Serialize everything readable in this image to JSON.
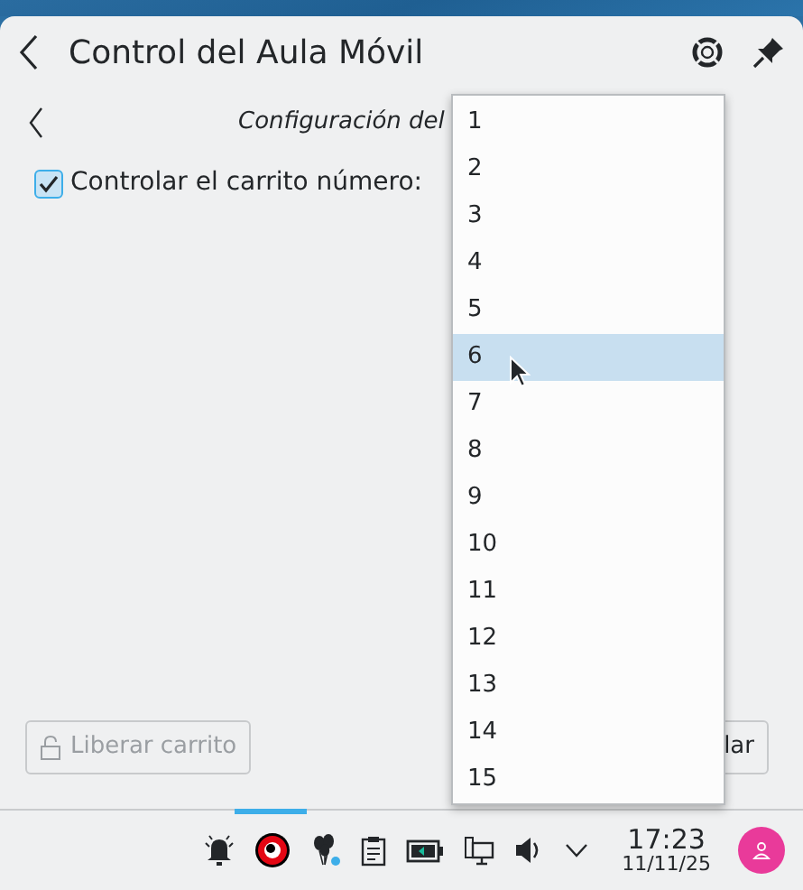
{
  "header": {
    "title": "Control del Aula Móvil"
  },
  "subheader": {
    "title": "Configuración del"
  },
  "carrito_checkbox": {
    "label": "Controlar el carrito número:",
    "checked": true
  },
  "dropdown": {
    "items": [
      {
        "label": "1",
        "selected": false
      },
      {
        "label": "2",
        "selected": false
      },
      {
        "label": "3",
        "selected": false
      },
      {
        "label": "4",
        "selected": false
      },
      {
        "label": "5",
        "selected": false
      },
      {
        "label": "6",
        "selected": true
      },
      {
        "label": "7",
        "selected": false
      },
      {
        "label": "8",
        "selected": false
      },
      {
        "label": "9",
        "selected": false
      },
      {
        "label": "10",
        "selected": false
      },
      {
        "label": "11",
        "selected": false
      },
      {
        "label": "12",
        "selected": false
      },
      {
        "label": "13",
        "selected": false
      },
      {
        "label": "14",
        "selected": false
      },
      {
        "label": "15",
        "selected": false
      }
    ]
  },
  "buttons": [
    {
      "label": "Liberar carrito",
      "disabled": true,
      "kind": "lock"
    },
    {
      "label": "lar",
      "disabled": false,
      "kind": "plain"
    }
  ],
  "taskbar": {
    "time": "17:23",
    "date": "11/11/25"
  }
}
